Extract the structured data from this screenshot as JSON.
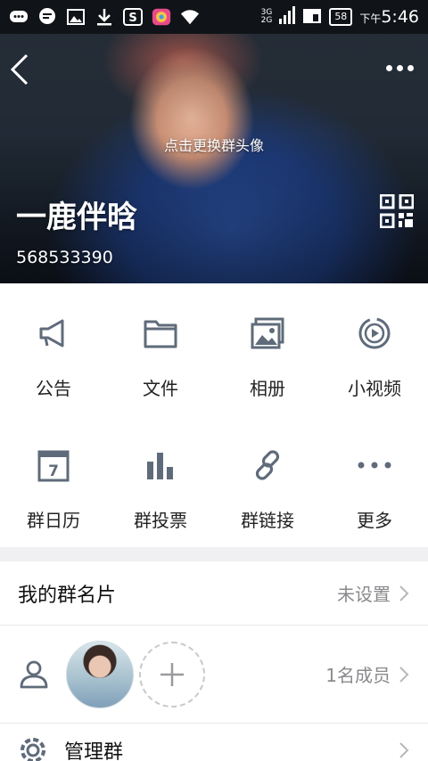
{
  "status_bar": {
    "network_top": "3G",
    "network_bottom": "2G",
    "battery": "58",
    "time_prefix": "下午",
    "time": "5:46",
    "icons": [
      "chat-bubble-icon",
      "message-icon",
      "image-icon",
      "download-icon",
      "s-app-icon",
      "game-icon",
      "wifi-icon",
      "signal-icon",
      "sim-icon",
      "battery-icon"
    ]
  },
  "header": {
    "change_avatar_hint": "点击更换群头像",
    "group_name": "一鹿伴晗",
    "group_id": "568533390"
  },
  "functions": [
    {
      "label": "公告",
      "icon": "megaphone-icon"
    },
    {
      "label": "文件",
      "icon": "folder-icon"
    },
    {
      "label": "相册",
      "icon": "album-icon"
    },
    {
      "label": "小视频",
      "icon": "video-icon"
    },
    {
      "label": "群日历",
      "icon": "calendar-icon"
    },
    {
      "label": "群投票",
      "icon": "vote-icon"
    },
    {
      "label": "群链接",
      "icon": "link-icon"
    },
    {
      "label": "更多",
      "icon": "more-dots-icon"
    }
  ],
  "calendar_day": "7",
  "my_card": {
    "title": "我的群名片",
    "value": "未设置"
  },
  "members": {
    "count_label": "1名成员"
  },
  "manage": {
    "title": "管理群"
  },
  "colors": {
    "icon_gray": "#5f6b7a",
    "value_gray": "#8a8a8e",
    "separator": "#f0f0f2"
  }
}
